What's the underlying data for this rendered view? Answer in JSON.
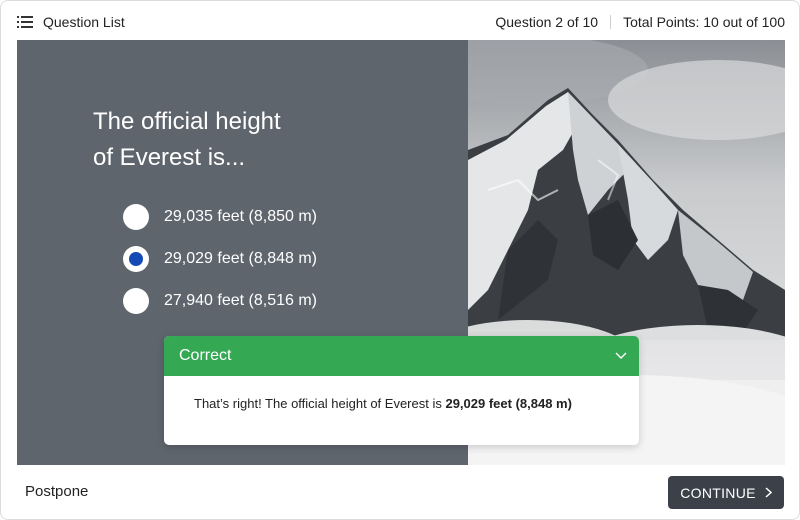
{
  "header": {
    "question_list_label": "Question List",
    "question_progress": "Question 2 of 10",
    "total_points": "Total Points: 10 out of 100"
  },
  "question": {
    "line1": "The official height",
    "line2": "of Everest is..."
  },
  "options": [
    {
      "label": "29,035 feet (8,850 m)",
      "selected": false
    },
    {
      "label": "29,029 feet (8,848 m)",
      "selected": true
    },
    {
      "label": "27,940 feet (8,516 m)",
      "selected": false
    }
  ],
  "feedback": {
    "title": "Correct",
    "message_prefix": "That’s right! The official height of Everest is ",
    "message_answer": "29,029 feet (8,848 m)",
    "color": "#34a853"
  },
  "footer": {
    "postpone_label": "Postpone",
    "continue_label": "CONTINUE"
  },
  "colors": {
    "panel": "#5f656d",
    "radio_selected": "#1549b3",
    "continue_button": "#3c4149"
  },
  "icons": {
    "question_list": "list-icon",
    "collapse": "chevron-down-icon",
    "continue": "chevron-right-icon",
    "photo": "mountain-photo"
  }
}
